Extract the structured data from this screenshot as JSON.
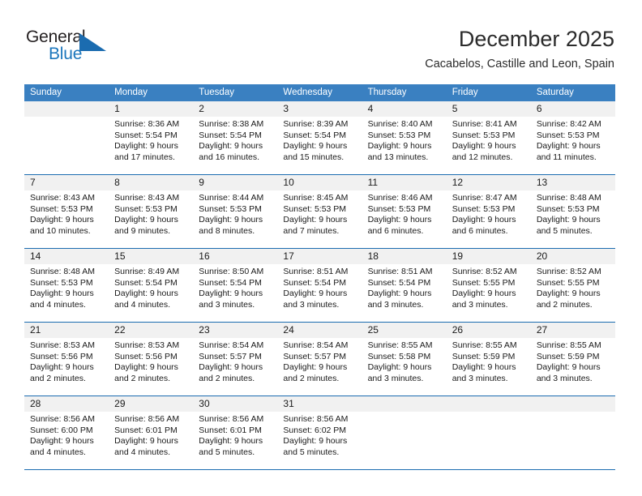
{
  "logo": {
    "word_top": "General",
    "word_bottom": "Blue",
    "accent_color": "#1b6cb0"
  },
  "header": {
    "title": "December 2025",
    "subtitle": "Cacabelos, Castille and Leon, Spain"
  },
  "calendar": {
    "header_bg": "#3a80c1",
    "weekdays": [
      "Sunday",
      "Monday",
      "Tuesday",
      "Wednesday",
      "Thursday",
      "Friday",
      "Saturday"
    ],
    "weeks": [
      [
        {
          "day": "",
          "sunrise": "",
          "sunset": "",
          "daylight_line1": "",
          "daylight_line2": ""
        },
        {
          "day": "1",
          "sunrise": "Sunrise: 8:36 AM",
          "sunset": "Sunset: 5:54 PM",
          "daylight_line1": "Daylight: 9 hours",
          "daylight_line2": "and 17 minutes."
        },
        {
          "day": "2",
          "sunrise": "Sunrise: 8:38 AM",
          "sunset": "Sunset: 5:54 PM",
          "daylight_line1": "Daylight: 9 hours",
          "daylight_line2": "and 16 minutes."
        },
        {
          "day": "3",
          "sunrise": "Sunrise: 8:39 AM",
          "sunset": "Sunset: 5:54 PM",
          "daylight_line1": "Daylight: 9 hours",
          "daylight_line2": "and 15 minutes."
        },
        {
          "day": "4",
          "sunrise": "Sunrise: 8:40 AM",
          "sunset": "Sunset: 5:53 PM",
          "daylight_line1": "Daylight: 9 hours",
          "daylight_line2": "and 13 minutes."
        },
        {
          "day": "5",
          "sunrise": "Sunrise: 8:41 AM",
          "sunset": "Sunset: 5:53 PM",
          "daylight_line1": "Daylight: 9 hours",
          "daylight_line2": "and 12 minutes."
        },
        {
          "day": "6",
          "sunrise": "Sunrise: 8:42 AM",
          "sunset": "Sunset: 5:53 PM",
          "daylight_line1": "Daylight: 9 hours",
          "daylight_line2": "and 11 minutes."
        }
      ],
      [
        {
          "day": "7",
          "sunrise": "Sunrise: 8:43 AM",
          "sunset": "Sunset: 5:53 PM",
          "daylight_line1": "Daylight: 9 hours",
          "daylight_line2": "and 10 minutes."
        },
        {
          "day": "8",
          "sunrise": "Sunrise: 8:43 AM",
          "sunset": "Sunset: 5:53 PM",
          "daylight_line1": "Daylight: 9 hours",
          "daylight_line2": "and 9 minutes."
        },
        {
          "day": "9",
          "sunrise": "Sunrise: 8:44 AM",
          "sunset": "Sunset: 5:53 PM",
          "daylight_line1": "Daylight: 9 hours",
          "daylight_line2": "and 8 minutes."
        },
        {
          "day": "10",
          "sunrise": "Sunrise: 8:45 AM",
          "sunset": "Sunset: 5:53 PM",
          "daylight_line1": "Daylight: 9 hours",
          "daylight_line2": "and 7 minutes."
        },
        {
          "day": "11",
          "sunrise": "Sunrise: 8:46 AM",
          "sunset": "Sunset: 5:53 PM",
          "daylight_line1": "Daylight: 9 hours",
          "daylight_line2": "and 6 minutes."
        },
        {
          "day": "12",
          "sunrise": "Sunrise: 8:47 AM",
          "sunset": "Sunset: 5:53 PM",
          "daylight_line1": "Daylight: 9 hours",
          "daylight_line2": "and 6 minutes."
        },
        {
          "day": "13",
          "sunrise": "Sunrise: 8:48 AM",
          "sunset": "Sunset: 5:53 PM",
          "daylight_line1": "Daylight: 9 hours",
          "daylight_line2": "and 5 minutes."
        }
      ],
      [
        {
          "day": "14",
          "sunrise": "Sunrise: 8:48 AM",
          "sunset": "Sunset: 5:53 PM",
          "daylight_line1": "Daylight: 9 hours",
          "daylight_line2": "and 4 minutes."
        },
        {
          "day": "15",
          "sunrise": "Sunrise: 8:49 AM",
          "sunset": "Sunset: 5:54 PM",
          "daylight_line1": "Daylight: 9 hours",
          "daylight_line2": "and 4 minutes."
        },
        {
          "day": "16",
          "sunrise": "Sunrise: 8:50 AM",
          "sunset": "Sunset: 5:54 PM",
          "daylight_line1": "Daylight: 9 hours",
          "daylight_line2": "and 3 minutes."
        },
        {
          "day": "17",
          "sunrise": "Sunrise: 8:51 AM",
          "sunset": "Sunset: 5:54 PM",
          "daylight_line1": "Daylight: 9 hours",
          "daylight_line2": "and 3 minutes."
        },
        {
          "day": "18",
          "sunrise": "Sunrise: 8:51 AM",
          "sunset": "Sunset: 5:54 PM",
          "daylight_line1": "Daylight: 9 hours",
          "daylight_line2": "and 3 minutes."
        },
        {
          "day": "19",
          "sunrise": "Sunrise: 8:52 AM",
          "sunset": "Sunset: 5:55 PM",
          "daylight_line1": "Daylight: 9 hours",
          "daylight_line2": "and 3 minutes."
        },
        {
          "day": "20",
          "sunrise": "Sunrise: 8:52 AM",
          "sunset": "Sunset: 5:55 PM",
          "daylight_line1": "Daylight: 9 hours",
          "daylight_line2": "and 2 minutes."
        }
      ],
      [
        {
          "day": "21",
          "sunrise": "Sunrise: 8:53 AM",
          "sunset": "Sunset: 5:56 PM",
          "daylight_line1": "Daylight: 9 hours",
          "daylight_line2": "and 2 minutes."
        },
        {
          "day": "22",
          "sunrise": "Sunrise: 8:53 AM",
          "sunset": "Sunset: 5:56 PM",
          "daylight_line1": "Daylight: 9 hours",
          "daylight_line2": "and 2 minutes."
        },
        {
          "day": "23",
          "sunrise": "Sunrise: 8:54 AM",
          "sunset": "Sunset: 5:57 PM",
          "daylight_line1": "Daylight: 9 hours",
          "daylight_line2": "and 2 minutes."
        },
        {
          "day": "24",
          "sunrise": "Sunrise: 8:54 AM",
          "sunset": "Sunset: 5:57 PM",
          "daylight_line1": "Daylight: 9 hours",
          "daylight_line2": "and 2 minutes."
        },
        {
          "day": "25",
          "sunrise": "Sunrise: 8:55 AM",
          "sunset": "Sunset: 5:58 PM",
          "daylight_line1": "Daylight: 9 hours",
          "daylight_line2": "and 3 minutes."
        },
        {
          "day": "26",
          "sunrise": "Sunrise: 8:55 AM",
          "sunset": "Sunset: 5:59 PM",
          "daylight_line1": "Daylight: 9 hours",
          "daylight_line2": "and 3 minutes."
        },
        {
          "day": "27",
          "sunrise": "Sunrise: 8:55 AM",
          "sunset": "Sunset: 5:59 PM",
          "daylight_line1": "Daylight: 9 hours",
          "daylight_line2": "and 3 minutes."
        }
      ],
      [
        {
          "day": "28",
          "sunrise": "Sunrise: 8:56 AM",
          "sunset": "Sunset: 6:00 PM",
          "daylight_line1": "Daylight: 9 hours",
          "daylight_line2": "and 4 minutes."
        },
        {
          "day": "29",
          "sunrise": "Sunrise: 8:56 AM",
          "sunset": "Sunset: 6:01 PM",
          "daylight_line1": "Daylight: 9 hours",
          "daylight_line2": "and 4 minutes."
        },
        {
          "day": "30",
          "sunrise": "Sunrise: 8:56 AM",
          "sunset": "Sunset: 6:01 PM",
          "daylight_line1": "Daylight: 9 hours",
          "daylight_line2": "and 5 minutes."
        },
        {
          "day": "31",
          "sunrise": "Sunrise: 8:56 AM",
          "sunset": "Sunset: 6:02 PM",
          "daylight_line1": "Daylight: 9 hours",
          "daylight_line2": "and 5 minutes."
        },
        {
          "day": "",
          "sunrise": "",
          "sunset": "",
          "daylight_line1": "",
          "daylight_line2": ""
        },
        {
          "day": "",
          "sunrise": "",
          "sunset": "",
          "daylight_line1": "",
          "daylight_line2": ""
        },
        {
          "day": "",
          "sunrise": "",
          "sunset": "",
          "daylight_line1": "",
          "daylight_line2": ""
        }
      ]
    ]
  }
}
